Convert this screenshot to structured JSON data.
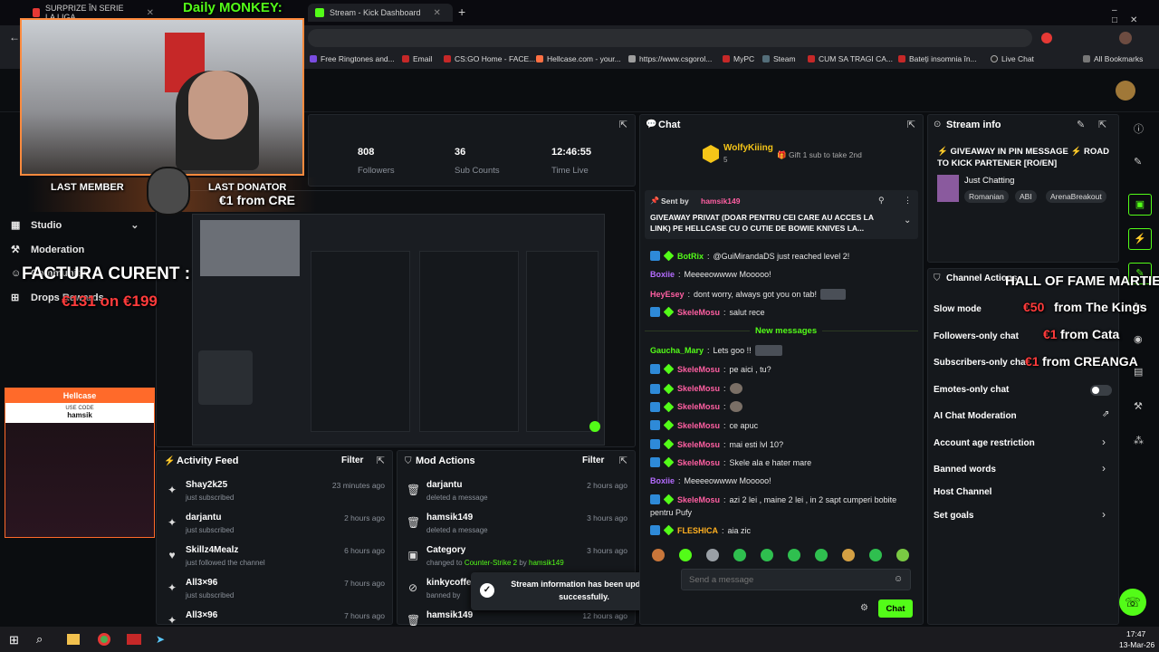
{
  "browser": {
    "tabs": [
      {
        "label": "SURPRIZE ÎN SERIE LA LIGA",
        "color": "#e53935"
      },
      {
        "label": "Stream - Kick Dashboard",
        "color": "#53fc18"
      }
    ],
    "bookmarks": [
      "Free Ringtones and...",
      "Email",
      "CS:GO Home - FACE...",
      "Hellcase.com - your...",
      "https://www.csgorol...",
      "MyPC",
      "Steam",
      "CUM SA TRAGI CA...",
      "Bateți insomnia în...",
      "Live Chat",
      "All Bookmarks"
    ]
  },
  "overlay": {
    "daily": "Daily MONKEY:",
    "last_member_label": "LAST MEMBER",
    "last_donator_label": "LAST DONATOR",
    "last_donator_value": "€1 from CRE",
    "factura_label": "FACTURA CURENT :",
    "factura_value": "€131 on €199",
    "hall_of_fame": "HALL OF FAME MARTIE:",
    "hof": [
      {
        "amount": "€50",
        "name": "from The Kings"
      },
      {
        "amount": "€1",
        "name": "from Cata"
      },
      {
        "amount": "€1",
        "name": "from CREANGA"
      }
    ],
    "hellcase": "Hellcase",
    "use_code": "USE CODE",
    "code": "hamsik"
  },
  "nav": {
    "studio": "Studio",
    "moderation": "Moderation",
    "community": "Community",
    "drops": "Drops Rewards"
  },
  "stats": [
    {
      "value": "808",
      "label": "Followers"
    },
    {
      "value": "36",
      "label": "Sub Counts"
    },
    {
      "value": "12:46:55",
      "label": "Time Live"
    }
  ],
  "activity": {
    "title": "Activity Feed",
    "filter": "Filter",
    "rows": [
      {
        "name": "Shay2k25",
        "action": "just subscribed",
        "time": "23 minutes ago",
        "icon": "subscribe-icon"
      },
      {
        "name": "darjantu",
        "action": "just subscribed",
        "time": "2 hours ago",
        "icon": "subscribe-icon"
      },
      {
        "name": "Skillz4Mealz",
        "action": "just followed the channel",
        "time": "6 hours ago",
        "icon": "heart-icon"
      },
      {
        "name": "All3×96",
        "action": "just subscribed",
        "time": "7 hours ago",
        "icon": "subscribe-icon"
      },
      {
        "name": "All3×96",
        "action": "",
        "time": "7 hours ago",
        "icon": "subscribe-icon"
      }
    ]
  },
  "mod": {
    "title": "Mod Actions",
    "filter": "Filter",
    "rows": [
      {
        "name": "darjantu",
        "action": "deleted a message",
        "time": "2 hours ago"
      },
      {
        "name": "hamsik149",
        "action": "deleted a message",
        "time": "3 hours ago"
      },
      {
        "name": "Category",
        "action_prefix": "changed to",
        "action_game": "Counter-Strike 2",
        "action_by": "by",
        "action_user": "hamsik149",
        "time": "3 hours ago"
      },
      {
        "name": "kinkycoffee",
        "action": "banned by",
        "time": ""
      },
      {
        "name": "hamsik149",
        "action": "",
        "time": "12 hours ago"
      }
    ]
  },
  "toast": {
    "line1": "Stream information has been updated",
    "line2": "successfully."
  },
  "chat": {
    "title": "Chat",
    "gifter": "WolfyKiiing",
    "gifter_count": "5",
    "gift_text": "Gift 1 sub to take 2nd",
    "pinned_sent_by": "Sent by",
    "pinned_user": "hamsik149",
    "pinned_text": "GIVEAWAY PRIVAT (DOAR PENTRU CEI CARE AU ACCES LA LINK) PE HELLCASE CU O CUTIE DE BOWIE KNIVES LA...",
    "new_messages": "New messages",
    "messages": [
      {
        "user": "BotRix",
        "color": "#53fc18",
        "text": "@GuiMirandaDS just reached level 2!",
        "badges": [
          "blue",
          "green"
        ]
      },
      {
        "user": "Boxiie",
        "color": "#b56cff",
        "text": "Meeeeowwww Mooooo!",
        "badges": []
      },
      {
        "user": "HeyEsey",
        "color": "#ff5fa2",
        "text": "dont worry, always got you on tab!",
        "badges": []
      },
      {
        "user": "SkeleMosu",
        "color": "#ff5fa2",
        "text": "salut rece",
        "badges": [
          "blue",
          "green"
        ]
      },
      {
        "user": "Gaucha_Mary",
        "color": "#53fc18",
        "text": "Lets goo !!",
        "badges": []
      },
      {
        "user": "SkeleMosu",
        "color": "#ff5fa2",
        "text": "pe aici , tu?",
        "badges": [
          "blue",
          "green"
        ]
      },
      {
        "user": "SkeleMosu",
        "color": "#ff5fa2",
        "text": "",
        "badges": [
          "blue",
          "green"
        ]
      },
      {
        "user": "SkeleMosu",
        "color": "#ff5fa2",
        "text": "",
        "badges": [
          "blue",
          "green"
        ]
      },
      {
        "user": "SkeleMosu",
        "color": "#ff5fa2",
        "text": "ce apuc",
        "badges": [
          "blue",
          "green"
        ]
      },
      {
        "user": "SkeleMosu",
        "color": "#ff5fa2",
        "text": "mai esti lvl 10?",
        "badges": [
          "blue",
          "green"
        ]
      },
      {
        "user": "SkeleMosu",
        "color": "#ff5fa2",
        "text": "Skele ala e hater mare",
        "badges": [
          "blue",
          "green"
        ]
      },
      {
        "user": "Boxiie",
        "color": "#b56cff",
        "text": "Meeeeowwww Mooooo!",
        "badges": []
      },
      {
        "user": "SkeleMosu",
        "color": "#ff5fa2",
        "text": "azi 2 lei , maine 2 lei , in 2 sapt cumperi bobite",
        "text2": "pentru Pufy",
        "badges": [
          "blue",
          "green"
        ]
      },
      {
        "user": "FLESHICA",
        "color": "#ffb020",
        "text": "aia zic",
        "badges": [
          "blue",
          "green"
        ]
      }
    ],
    "input_placeholder": "Send a message",
    "send": "Chat"
  },
  "stream_info": {
    "title": "Stream info",
    "stream_title": "⚡ GIVEAWAY IN PIN MESSAGE ⚡ ROAD TO KICK PARTENER [RO/EN]",
    "category": "Just Chatting",
    "tags": [
      "Romanian",
      "ABI",
      "ArenaBreakout"
    ]
  },
  "channel_actions": {
    "title": "Channel Actions",
    "items": [
      {
        "label": "Slow mode",
        "type": "toggle"
      },
      {
        "label": "Followers-only chat",
        "type": "toggle"
      },
      {
        "label": "Subscribers-only chat",
        "type": "toggle"
      },
      {
        "label": "Emotes-only chat",
        "type": "toggle"
      },
      {
        "label": "AI Chat Moderation",
        "type": "link"
      },
      {
        "label": "Account age restriction",
        "type": "chevron"
      },
      {
        "label": "Banned words",
        "type": "chevron"
      },
      {
        "label": "Host Channel",
        "type": "none"
      },
      {
        "label": "Set goals",
        "type": "chevron"
      }
    ]
  },
  "taskbar": {
    "time": "17:47",
    "date": "13-Mar-26"
  }
}
